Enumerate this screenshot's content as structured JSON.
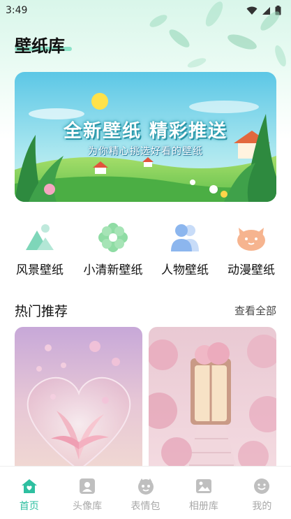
{
  "status_bar": {
    "time": "3:49"
  },
  "app": {
    "title": "壁纸库"
  },
  "banner": {
    "title": "全新壁纸 精彩推送",
    "subtitle": "为你精心挑选好看的壁纸"
  },
  "categories": [
    {
      "label": "风景壁纸",
      "icon": "landscape-icon"
    },
    {
      "label": "小清新壁纸",
      "icon": "flower-icon"
    },
    {
      "label": "人物壁纸",
      "icon": "people-icon"
    },
    {
      "label": "动漫壁纸",
      "icon": "cat-icon"
    }
  ],
  "hot": {
    "title": "热门推荐",
    "see_all": "查看全部"
  },
  "tabbar": [
    {
      "label": "首页",
      "icon": "home-icon",
      "active": true
    },
    {
      "label": "头像库",
      "icon": "avatar-icon",
      "active": false
    },
    {
      "label": "表情包",
      "icon": "emoji-pack-icon",
      "active": false
    },
    {
      "label": "相册库",
      "icon": "album-icon",
      "active": false
    },
    {
      "label": "我的",
      "icon": "profile-icon",
      "active": false
    }
  ],
  "colors": {
    "accent": "#2ebfa0",
    "inactive": "#a8a8a8"
  }
}
